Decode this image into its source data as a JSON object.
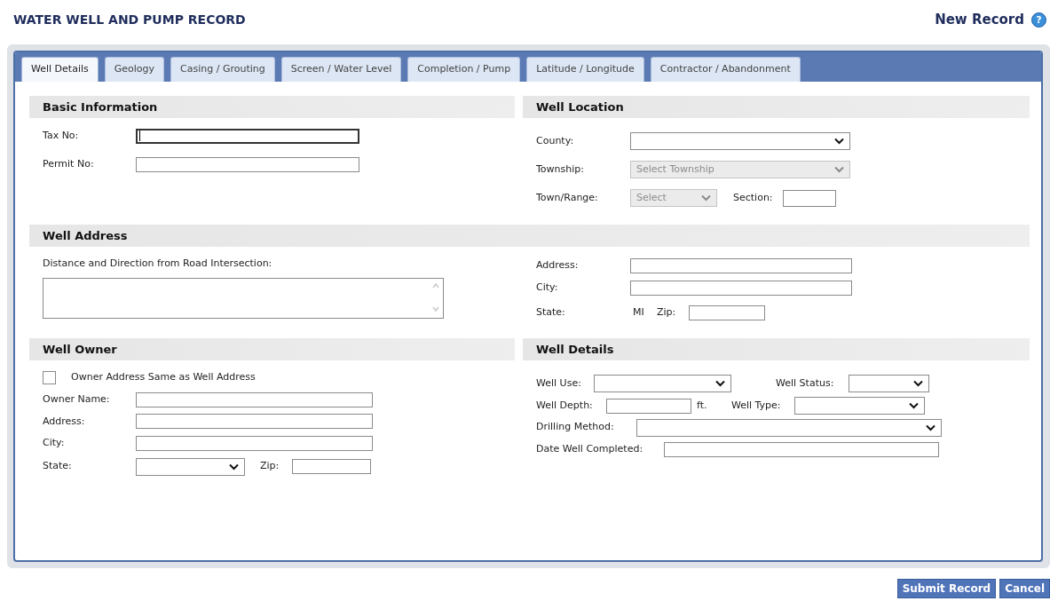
{
  "title": "WATER WELL AND PUMP RECORD",
  "record_status": "New Record",
  "help": "?",
  "tabs": [
    {
      "label": "Well Details",
      "selected": true
    },
    {
      "label": "Geology",
      "selected": false
    },
    {
      "label": "Casing / Grouting",
      "selected": false
    },
    {
      "label": "Screen / Water Level",
      "selected": false
    },
    {
      "label": "Completion / Pump",
      "selected": false
    },
    {
      "label": "Latitude / Longitude",
      "selected": false
    },
    {
      "label": "Contractor / Abandonment",
      "selected": false
    }
  ],
  "basic_information": {
    "heading": "Basic Information",
    "fields": [
      {
        "label": "Tax No:",
        "focused": true
      },
      {
        "label": "Permit No:",
        "focused": false
      }
    ]
  },
  "well_location": {
    "heading": "Well Location",
    "county": {
      "label": "County:",
      "disabled": false
    },
    "township": {
      "label": "Township:",
      "value": "Select Township",
      "disabled": true
    },
    "town_range": {
      "label": "Town/Range:",
      "value": "Select",
      "disabled": true
    },
    "section": {
      "label": "Section:"
    }
  },
  "well_address": {
    "heading": "Well Address",
    "distance_label": "Distance and Direction from Road Intersection:",
    "address": {
      "label": "Address:"
    },
    "city": {
      "label": "City:"
    },
    "state": {
      "label": "State:",
      "value": "MI"
    },
    "zip": {
      "label": "Zip:"
    }
  },
  "well_owner": {
    "heading": "Well Owner",
    "same_address": {
      "label": "Owner Address Same as Well Address",
      "checked": false
    },
    "owner_name": {
      "label": "Owner Name:"
    },
    "address": {
      "label": "Address:"
    },
    "city": {
      "label": "City:"
    },
    "state": {
      "label": "State:"
    },
    "zip": {
      "label": "Zip:"
    }
  },
  "well_details": {
    "heading": "Well Details",
    "well_use": {
      "label": "Well Use:"
    },
    "well_status": {
      "label": "Well Status:"
    },
    "well_depth": {
      "label": "Well Depth:",
      "unit": "ft."
    },
    "well_type": {
      "label": "Well Type:"
    },
    "drilling_method": {
      "label": "Drilling Method:"
    },
    "date_completed": {
      "label": "Date Well Completed:"
    }
  },
  "buttons": [
    {
      "label": "Submit Record"
    },
    {
      "label": "Cancel"
    }
  ]
}
